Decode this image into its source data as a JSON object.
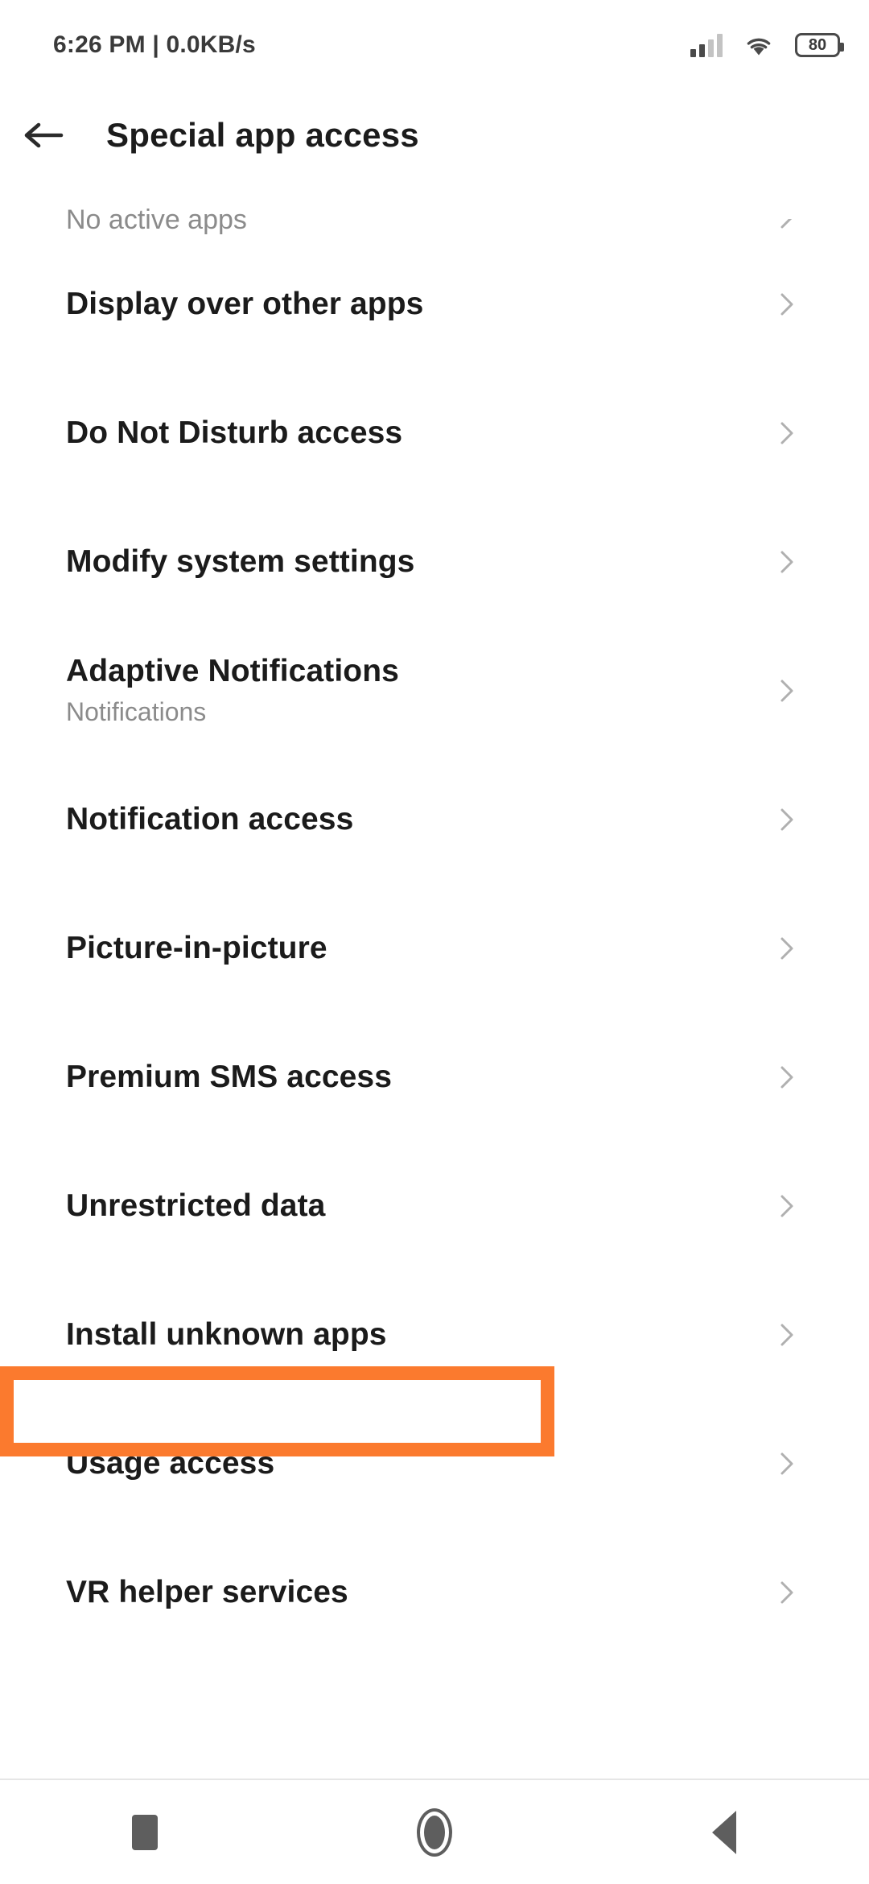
{
  "status_bar": {
    "time_and_speed": "6:26 PM | 0.0KB/s",
    "battery_level": "80",
    "signal_icon": "signal-bars-icon",
    "wifi_icon": "wifi-icon",
    "battery_icon": "battery-icon"
  },
  "header": {
    "back_icon": "back-arrow-icon",
    "title": "Special app access"
  },
  "colors": {
    "highlight": "#FB7A2E",
    "title_text": "#1b1b1b",
    "secondary_text": "#8b8b8b",
    "chevron": "#b0b0b0"
  },
  "list": {
    "partial_row": {
      "subtitle": "No active apps",
      "chevron_icon": "chevron-right-icon"
    },
    "items": [
      {
        "title": "Display over other apps",
        "subtitle": "",
        "chevron_icon": "chevron-right-icon",
        "highlighted": false
      },
      {
        "title": "Do Not Disturb access",
        "subtitle": "",
        "chevron_icon": "chevron-right-icon",
        "highlighted": false
      },
      {
        "title": "Modify system settings",
        "subtitle": "",
        "chevron_icon": "chevron-right-icon",
        "highlighted": false
      },
      {
        "title": "Adaptive Notifications",
        "subtitle": "Notifications",
        "chevron_icon": "chevron-right-icon",
        "highlighted": false
      },
      {
        "title": "Notification access",
        "subtitle": "",
        "chevron_icon": "chevron-right-icon",
        "highlighted": false
      },
      {
        "title": "Picture-in-picture",
        "subtitle": "",
        "chevron_icon": "chevron-right-icon",
        "highlighted": false
      },
      {
        "title": "Premium SMS access",
        "subtitle": "",
        "chevron_icon": "chevron-right-icon",
        "highlighted": false
      },
      {
        "title": "Unrestricted data",
        "subtitle": "",
        "chevron_icon": "chevron-right-icon",
        "highlighted": false
      },
      {
        "title": "Install unknown apps",
        "subtitle": "",
        "chevron_icon": "chevron-right-icon",
        "highlighted": true
      },
      {
        "title": "Usage access",
        "subtitle": "",
        "chevron_icon": "chevron-right-icon",
        "highlighted": false
      },
      {
        "title": "VR helper services",
        "subtitle": "",
        "chevron_icon": "chevron-right-icon",
        "highlighted": false
      }
    ]
  },
  "nav_bar": {
    "recents_icon": "square-recents-icon",
    "home_icon": "circle-home-icon",
    "back_icon": "triangle-back-icon"
  }
}
